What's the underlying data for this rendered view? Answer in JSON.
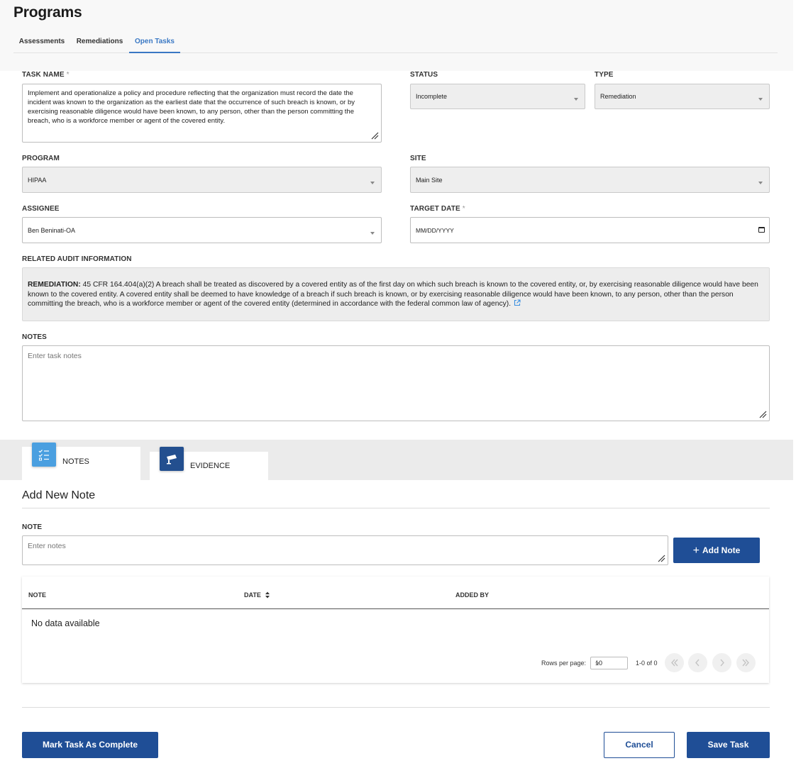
{
  "page": {
    "title": "Programs"
  },
  "tabs": [
    {
      "label": "Assessments"
    },
    {
      "label": "Remediations"
    },
    {
      "label": "Open Tasks",
      "active": true
    }
  ],
  "form": {
    "task_name": {
      "label": "TASK NAME",
      "required_mark": "*",
      "value": "Implement and operationalize a policy and procedure reflecting that the organization must record the date the incident was known to the organization as the earliest date that the occurrence of such breach is known, or by exercising reasonable diligence would have been known, to any person, other than the person committing the breach, who is a workforce member or agent of the covered entity."
    },
    "status": {
      "label": "STATUS",
      "value": "Incomplete"
    },
    "type": {
      "label": "TYPE",
      "value": "Remediation"
    },
    "program": {
      "label": "PROGRAM",
      "value": "HIPAA"
    },
    "site": {
      "label": "SITE",
      "value": "Main Site"
    },
    "assignee": {
      "label": "ASSIGNEE",
      "value": "Ben Beninati-OA"
    },
    "target_date": {
      "label": "TARGET DATE",
      "required_mark": "*",
      "placeholder": "MM/DD/YYYY"
    },
    "related_audit": {
      "label": "RELATED AUDIT INFORMATION",
      "prefix": "REMEDIATION:",
      "text": "45 CFR 164.404(a)(2) A breach shall be treated as discovered by a covered entity as of the first day on which such breach is known to the covered entity, or, by exercising reasonable diligence would have been known to the covered entity. A covered entity shall be deemed to have knowledge of a breach if such breach is known, or by exercising reasonable diligence would have been known, to any person, other than the person committing the breach, who is a workforce member or agent of the covered entity (determined in accordance with the federal common law of agency)."
    },
    "notes": {
      "label": "NOTES",
      "placeholder": "Enter task notes"
    }
  },
  "content_tabs": [
    {
      "label": "NOTES",
      "icon": "checklist-icon",
      "active": true
    },
    {
      "label": "EVIDENCE",
      "icon": "camera-icon",
      "active": false
    }
  ],
  "add_note": {
    "title": "Add New Note",
    "note_label": "NOTE",
    "placeholder": "Enter notes",
    "button": "Add Note"
  },
  "table": {
    "columns": [
      "NOTE",
      "DATE",
      "ADDED BY"
    ],
    "empty_text": "No data available",
    "rows_per_page_label": "Rows per page:",
    "rows_per_page": "10",
    "range": "1-0 of 0"
  },
  "footer": {
    "complete_button": "Mark Task As Complete",
    "cancel_button": "Cancel",
    "save_button": "Save Task"
  },
  "colors": {
    "primary": "#1f4e96",
    "active_tab": "#3a78c4",
    "notes_icon_bg": "#4a9fe0",
    "evidence_icon_bg": "#234f8f"
  }
}
